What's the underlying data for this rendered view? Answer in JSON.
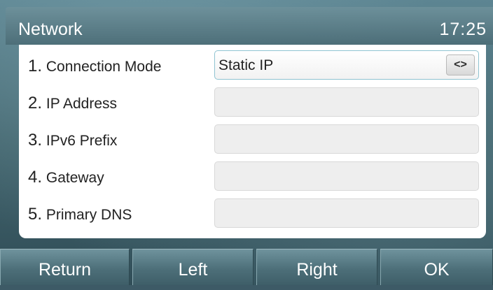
{
  "header": {
    "title": "Network",
    "time": "17:25"
  },
  "rows": [
    {
      "number": "1.",
      "label": "Connection Mode",
      "value": "Static IP"
    },
    {
      "number": "2.",
      "label": "IP Address",
      "value": ""
    },
    {
      "number": "3.",
      "label": "IPv6 Prefix",
      "value": ""
    },
    {
      "number": "4.",
      "label": "Gateway",
      "value": ""
    },
    {
      "number": "5.",
      "label": "Primary  DNS",
      "value": ""
    }
  ],
  "toggle": {
    "glyph": "<>",
    "icon": "left-right-switch-icon"
  },
  "softkeys": [
    "Return",
    "Left",
    "Right",
    "OK"
  ],
  "colors": {
    "panel": "#ffffff",
    "active_border": "#8fc3d1",
    "background": "#44666f"
  }
}
